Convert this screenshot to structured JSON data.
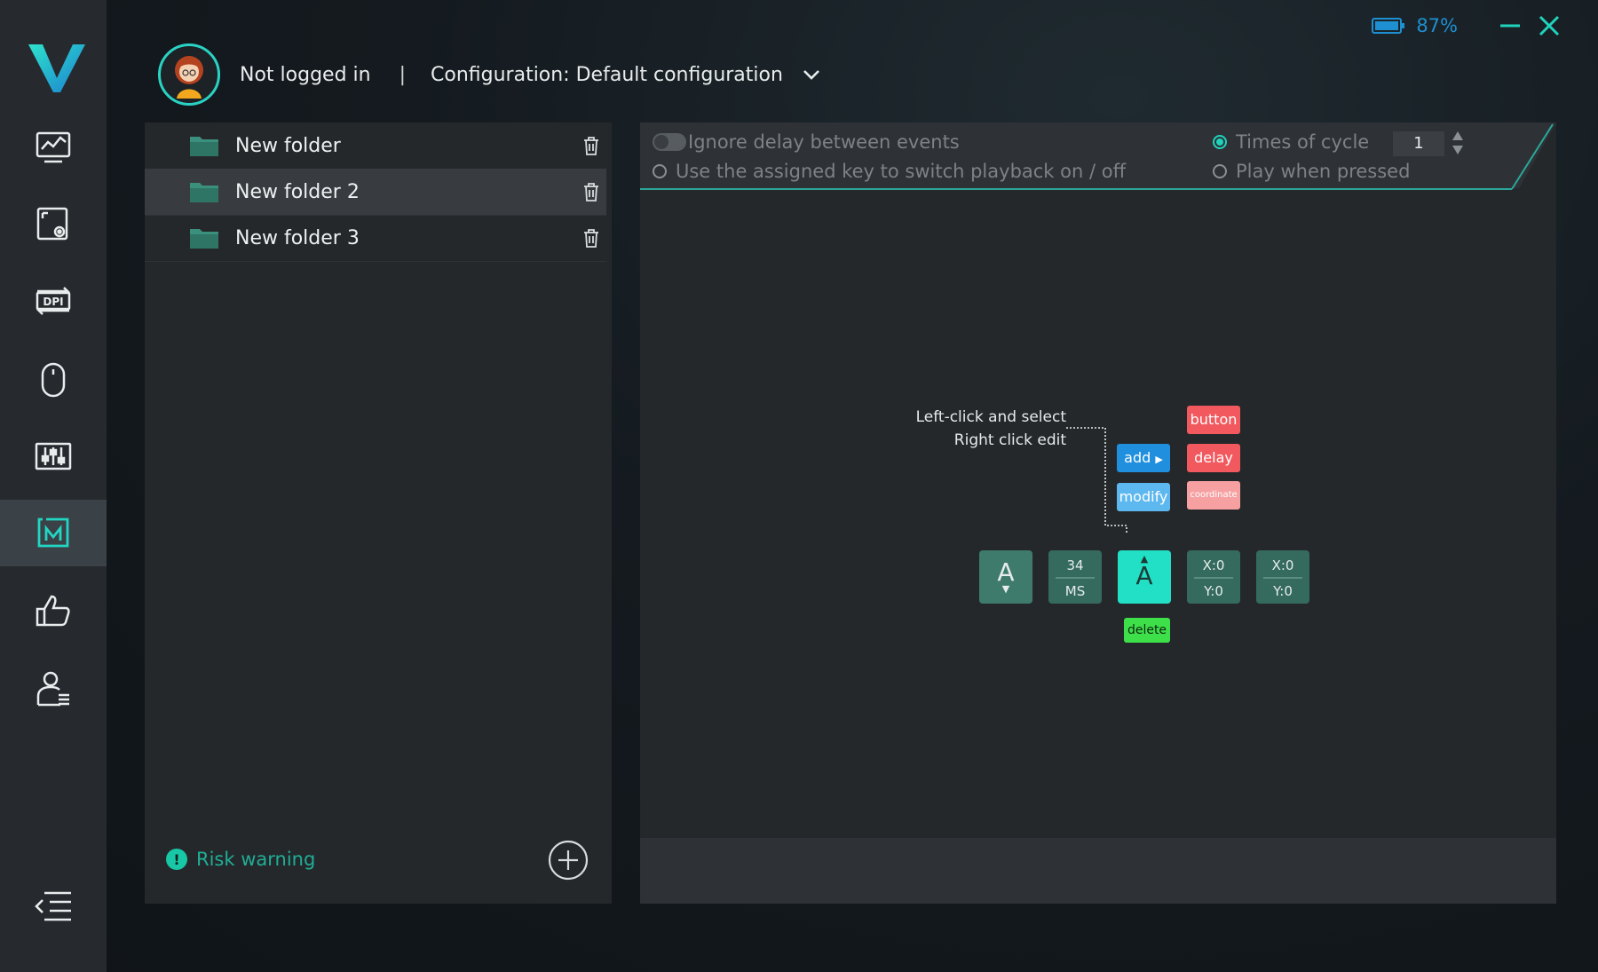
{
  "colors": {
    "accent": "#20d3bd",
    "battery": "#1e8fd0",
    "danger_chip": "#f1595e",
    "add_chip": "#1f8fde",
    "delete_chip": "#3ee04a"
  },
  "sidebar": {
    "items": [
      {
        "name": "monitor-chart-icon"
      },
      {
        "name": "screen-settings-icon"
      },
      {
        "name": "dpi-icon"
      },
      {
        "name": "mouse-icon"
      },
      {
        "name": "equalizer-icon"
      },
      {
        "name": "macro-icon",
        "active": true
      },
      {
        "name": "thumbs-up-icon"
      },
      {
        "name": "user-list-icon"
      }
    ]
  },
  "header": {
    "login_status": "Not logged in",
    "separator": "|",
    "configuration": "Configuration: Default configuration"
  },
  "status": {
    "battery": "87%"
  },
  "folders": [
    {
      "name": "New folder"
    },
    {
      "name": "New folder 2",
      "selected": true
    },
    {
      "name": "New folder 3"
    }
  ],
  "left_footer": {
    "risk_icon": "!",
    "risk_warning": "Risk warning"
  },
  "options": {
    "ignore_delay": "Ignore delay between events",
    "assigned_key": "Use the assigned key to switch playback on / off",
    "times_of_cycle": "Times of cycle",
    "cycle_value": "1",
    "play_when_pressed": "Play when pressed"
  },
  "guide": {
    "line1": "Left-click and select",
    "line2": "Right click edit",
    "add": "add",
    "modify": "modify",
    "button": "button",
    "delay": "delay",
    "coordinate": "coordinate",
    "delete": "delete"
  },
  "tiles": [
    {
      "top": "A",
      "bottom": ""
    },
    {
      "top": "34",
      "bottom": "MS"
    },
    {
      "top": "A",
      "bottom": ""
    },
    {
      "top": "X:0",
      "bottom": "Y:0"
    },
    {
      "top": "X:0",
      "bottom": "Y:0"
    }
  ]
}
